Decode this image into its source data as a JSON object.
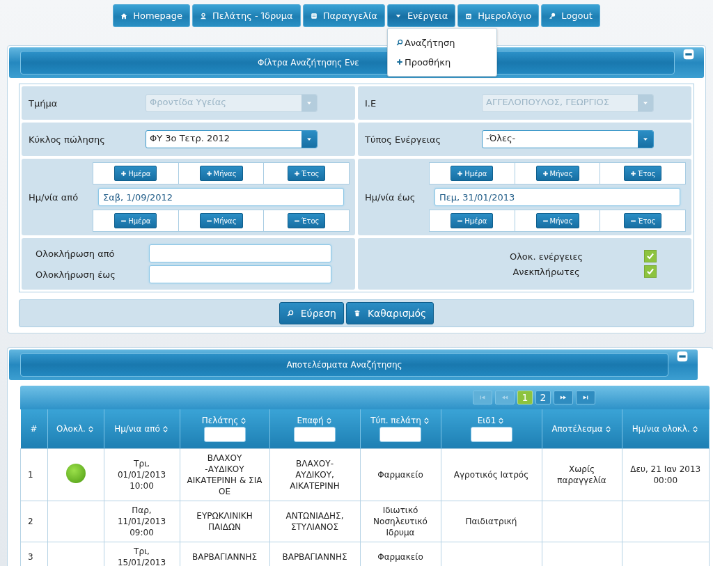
{
  "nav": [
    {
      "label": "Homepage",
      "expanded": false
    },
    {
      "label": "Πελάτης - Ίδρυμα",
      "expanded": false
    },
    {
      "label": "Παραγγελία",
      "expanded": false
    },
    {
      "label": "Ενέργεια",
      "expanded": true
    },
    {
      "label": "Ημερολόγιο",
      "expanded": false
    },
    {
      "label": "Logout",
      "expanded": false
    }
  ],
  "dropdown": [
    {
      "label": "Αναζήτηση"
    },
    {
      "label": "Προσθήκη"
    }
  ],
  "filter_panel": {
    "title": "Φίλτρα Αναζήτησης Ενε",
    "department": {
      "label": "Τμήμα",
      "value": "Φροντίδα Υγείας",
      "disabled": true
    },
    "rep": {
      "label": "Ι.Ε",
      "value": "ΑΓΓΕΛΟΠΟΥΛΟΣ, ΓΕΩΡΓΙΟΣ",
      "disabled": true
    },
    "cycle": {
      "label": "Κύκλος πώλησης",
      "value": "ΦΥ 3ο Τετρ. 2012",
      "disabled": false
    },
    "action_type": {
      "label": "Τύπος Ενέργειας",
      "value": "-Όλες-",
      "disabled": false
    },
    "date_ranges": [
      {
        "label": "Ημ/νία από",
        "value": "Σαβ, 1/09/2012",
        "plus": [
          "Ημέρα",
          "Μήνας",
          "Έτος"
        ],
        "minus": [
          "Ημέρα",
          "Μήνας",
          "Έτος"
        ]
      },
      {
        "label": "Ημ/νία έως",
        "value": "Πεμ, 31/01/2013",
        "plus": [
          "Ημέρα",
          "Μήνας",
          "Έτος"
        ],
        "minus": [
          "Ημέρα",
          "Μήνας",
          "Έτος"
        ]
      }
    ],
    "completion_fields": [
      {
        "label": "Ολοκλήρωση από"
      },
      {
        "label": "Ολοκλήρωση έως"
      }
    ],
    "checks": [
      {
        "label": "Ολοκ. ενέργειες",
        "checked": true
      },
      {
        "label": "Ανεκπλήρωτες",
        "checked": true
      }
    ],
    "buttons": [
      {
        "label": "Εύρεση"
      },
      {
        "label": "Καθαρισμός"
      }
    ]
  },
  "results_panel": {
    "title": "Αποτελέσματα Αναζήτησης",
    "pager": {
      "pages": [
        {
          "label": "1",
          "selected": true
        },
        {
          "label": "2",
          "selected": false
        }
      ]
    },
    "columns": [
      {
        "label": "#",
        "sortable": false,
        "filter": false
      },
      {
        "label": "Ολοκλ.",
        "sortable": true,
        "filter": false
      },
      {
        "label": "Ημ/νια από",
        "sortable": true,
        "filter": false
      },
      {
        "label": "Πελάτης",
        "sortable": true,
        "filter": true
      },
      {
        "label": "Επαφή",
        "sortable": true,
        "filter": true
      },
      {
        "label": "Τύπ. πελάτη",
        "sortable": true,
        "filter": true
      },
      {
        "label": "Ειδ1",
        "sortable": true,
        "filter": true
      },
      {
        "label": "Αποτέλεσμα",
        "sortable": true,
        "filter": false
      },
      {
        "label": "Ημ/νια ολοκλ.",
        "sortable": true,
        "filter": false
      }
    ],
    "rows": [
      {
        "num": "1",
        "completed": true,
        "date_from": "Τρι, 01/01/2013 10:00",
        "customer": "ΒΛΑΧΟΥ -ΑΥΔΙΚΟΥ ΑΙΚΑΤΕΡΙΝΗ & ΣΙΑ ΟΕ",
        "contact": "ΒΛΑΧΟΥ- ΑΥΔΙΚΟΥ, ΑΙΚΑΤΕΡΙΝΗ",
        "customer_type": "Φαρμακείο",
        "specialty": "Αγροτικός Ιατρός",
        "result": "Χωρίς παραγγελία",
        "date_done": "Δευ, 21 Ιαν 2013 00:00"
      },
      {
        "num": "2",
        "completed": false,
        "date_from": "Παρ, 11/01/2013 09:00",
        "customer": "ΕΥΡΩΚΛΙΝΙΚΗ ΠΑΙΔΩΝ",
        "contact": "ΑΝΤΩΝΙΑΔΗΣ, ΣΤΥΛΙΑΝΟΣ",
        "customer_type": "Ιδιωτικό Νοσηλευτικό Ιδρυμα",
        "specialty": "Παιδιατρική"
      },
      {
        "num": "3",
        "completed": false,
        "date_from": "Τρι, 15/01/2013",
        "customer": "ΒΑΡΒΑΓΙΑΝΝΗΣ",
        "contact": "ΒΑΡΒΑΓΙΑΝΝΗΣ",
        "customer_type": "Φαρμακείο"
      }
    ]
  }
}
